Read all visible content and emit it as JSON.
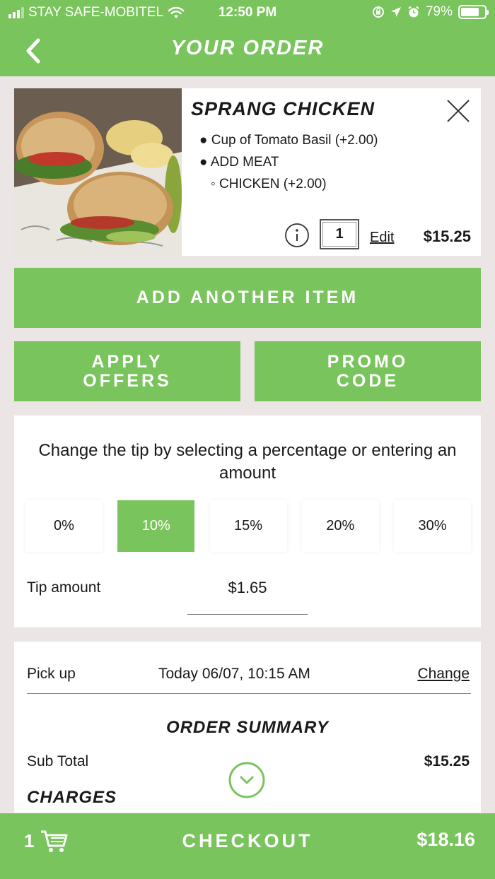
{
  "status_bar": {
    "carrier": "STAY SAFE-MOBITEL",
    "time": "12:50 PM",
    "battery": "79%",
    "battery_level": 0.79,
    "icons": [
      "signal-icon",
      "wifi-icon",
      "orientation-lock-icon",
      "location-icon",
      "alarm-icon",
      "battery-icon"
    ]
  },
  "header": {
    "title": "YOUR ORDER",
    "back_icon": "chevron-left-icon"
  },
  "item": {
    "name": "SPRANG CHICKEN",
    "options": [
      "Cup of Tomato Basil (+2.00)",
      "ADD MEAT"
    ],
    "sub_option": "CHICKEN (+2.00)",
    "quantity": "1",
    "edit_label": "Edit",
    "price": "$15.25",
    "image": "sandwich-photo"
  },
  "buttons": {
    "add_another": "ADD ANOTHER ITEM",
    "apply_offers_line1": "APPLY",
    "apply_offers_line2": "OFFERS",
    "promo_line1": "PROMO",
    "promo_line2": "CODE"
  },
  "tip": {
    "instruction": "Change the tip by selecting a percentage or entering an amount",
    "options": [
      "0%",
      "10%",
      "15%",
      "20%",
      "30%"
    ],
    "selected": "10%",
    "amount_label": "Tip amount",
    "amount_value": "$1.65"
  },
  "order": {
    "pickup_label": "Pick up",
    "pickup_time": "Today 06/07, 10:15 AM",
    "change_label": "Change",
    "summary_title": "ORDER SUMMARY",
    "subtotal_label": "Sub Total",
    "subtotal_value": "$15.25",
    "charges_title": "CHARGES"
  },
  "checkout": {
    "cart_count": "1",
    "label": "CHECKOUT",
    "total": "$18.16"
  },
  "colors": {
    "accent": "#79c45c",
    "background": "#ebe5e5"
  }
}
